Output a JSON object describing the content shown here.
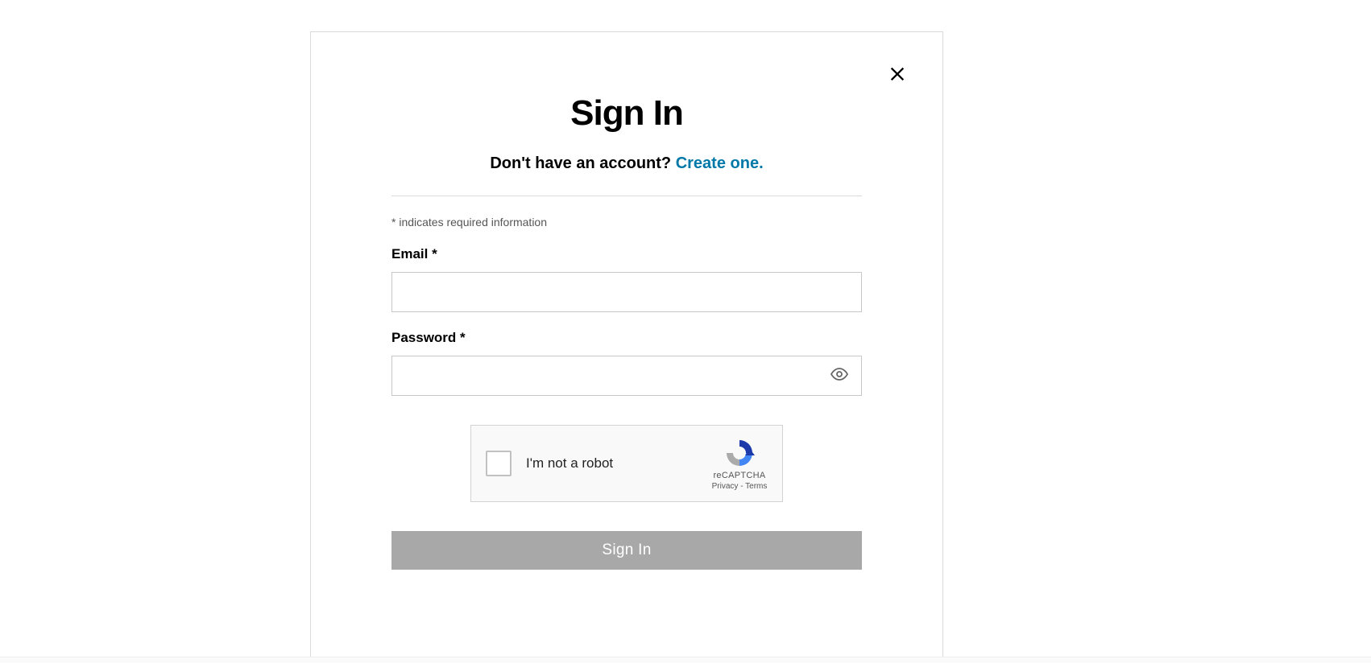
{
  "modal": {
    "title": "Sign In",
    "subtitle_prefix": "Don't have an account? ",
    "create_link": "Create one.",
    "required_note_asterisk": "*",
    "required_note_text": " indicates required information",
    "email_label": "Email *",
    "email_value": "",
    "password_label": "Password *",
    "password_value": "",
    "submit_label": "Sign In"
  },
  "recaptcha": {
    "label": "I'm not a robot",
    "brand": "reCAPTCHA",
    "privacy": "Privacy",
    "separator": " - ",
    "terms": "Terms"
  }
}
